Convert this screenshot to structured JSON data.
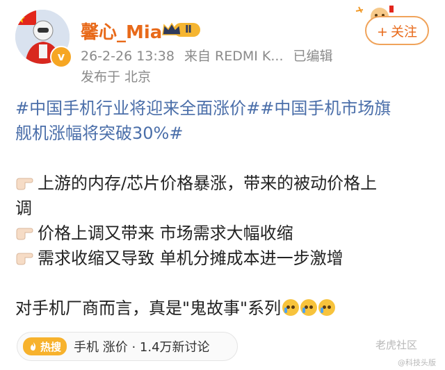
{
  "user": {
    "name": "馨心_Mia",
    "level_badge": "Ⅱ",
    "verified_mark": "v"
  },
  "post": {
    "date": "26-2-26 13:38",
    "source": "来自 REDMI K...",
    "edited": "已编辑",
    "location": "发布于 北京",
    "topic_line1": "#中国手机行业将迎来全面涨价##中国手机市场旗",
    "topic_line2": "舰机涨幅将突破30%#",
    "bullet1_line1": "上游的内存/芯片价格暴涨，带来的被动价格上",
    "bullet1_line2": "调",
    "bullet2": "价格上调又带来 市场需求大幅收缩",
    "bullet3": "需求收缩又导致 单机分摊成本进一步激增",
    "closing": "对手机厂商而言，真是\"鬼故事\"系列"
  },
  "follow_button": {
    "plus": "+",
    "label": "关注"
  },
  "hot_search": {
    "tag": "热搜",
    "text": "手机 涨价 · 1.4万新讨论"
  },
  "watermark": {
    "main": "老虎社区",
    "sub": "@科技头版"
  },
  "icons": {
    "hand": "pointing-right-hand-icon",
    "emoji": "crying-face-icon",
    "flame": "flame-icon"
  },
  "colors": {
    "username": "#e86a1a",
    "topic": "#4a6ea9",
    "meta": "#8a8a8a",
    "hot_tag": "#f7b22d"
  }
}
